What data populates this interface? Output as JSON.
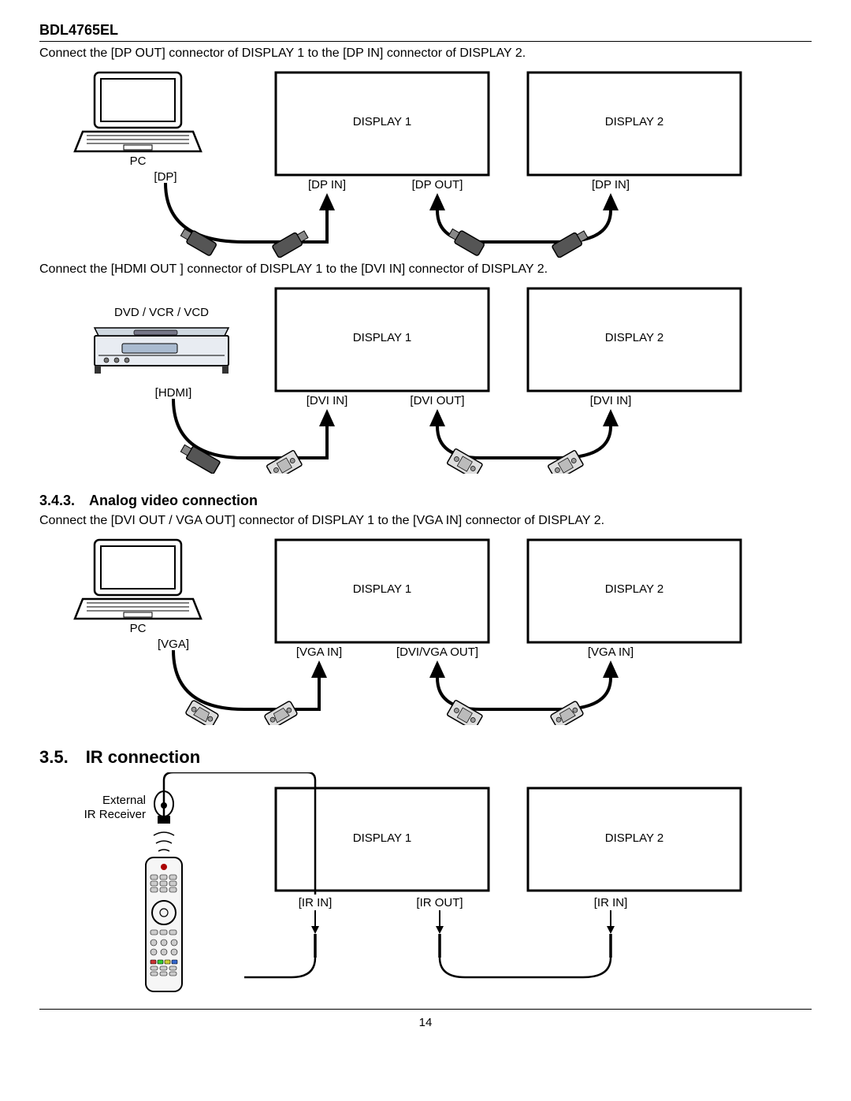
{
  "header": {
    "model": "BDL4765EL"
  },
  "dp": {
    "intro": "Connect the [DP OUT] connector of DISPLAY 1 to the [DP IN] connector of DISPLAY 2.",
    "source_label": "PC",
    "source_port": "[DP]",
    "display1": "DISPLAY 1",
    "display2": "DISPLAY 2",
    "d1_in": "[DP IN]",
    "d1_out": "[DP OUT]",
    "d2_in": "[DP IN]"
  },
  "hdmi": {
    "intro": "Connect the [HDMI OUT ] connector of DISPLAY 1 to the [DVI IN] connector of DISPLAY 2.",
    "source_label": "DVD / VCR / VCD",
    "source_port": "[HDMI]",
    "display1": "DISPLAY 1",
    "display2": "DISPLAY 2",
    "d1_in": "[DVI IN]",
    "d1_out": "[DVI OUT]",
    "d2_in": "[DVI IN]"
  },
  "analog": {
    "heading": "3.4.3. Analog video connection",
    "intro": "Connect the [DVI OUT / VGA OUT] connector of DISPLAY 1 to the [VGA IN] connector of DISPLAY 2.",
    "source_label": "PC",
    "source_port": "[VGA]",
    "display1": "DISPLAY 1",
    "display2": "DISPLAY 2",
    "d1_in": "[VGA IN]",
    "d1_out": "[DVI/VGA OUT]",
    "d2_in": "[VGA IN]"
  },
  "ir": {
    "heading": "3.5. IR connection",
    "receiver": "External IR Receiver",
    "display1": "DISPLAY 1",
    "display2": "DISPLAY 2",
    "d1_in": "[IR IN]",
    "d1_out": "[IR OUT]",
    "d2_in": "[IR IN]"
  },
  "pagenum": "14"
}
